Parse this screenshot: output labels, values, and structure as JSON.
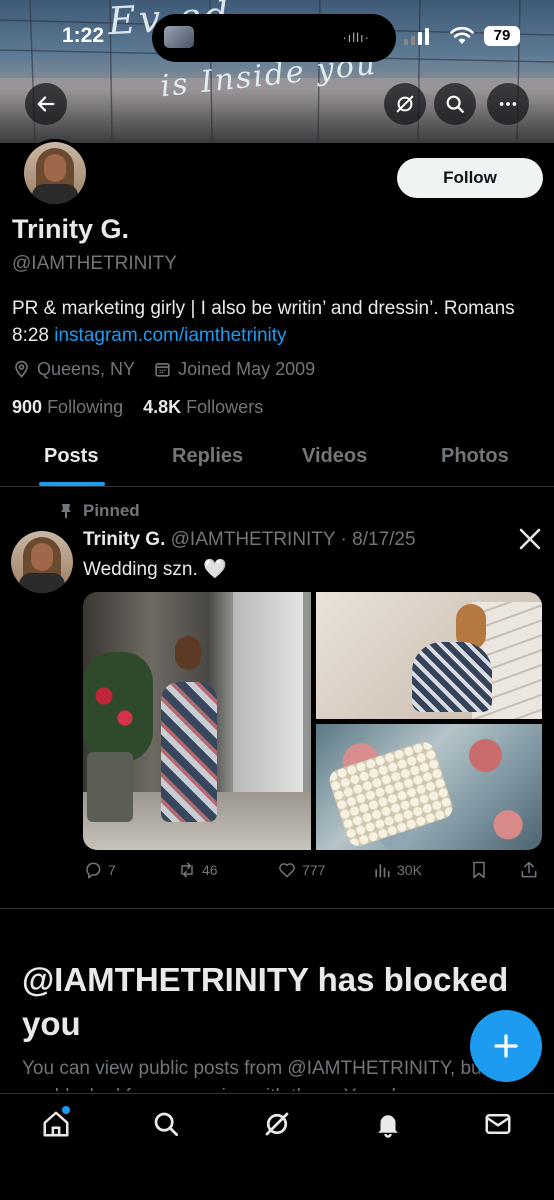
{
  "status_bar": {
    "time": "1:22",
    "battery": "79"
  },
  "banner": {
    "line1": "Ev        ed",
    "line2": "is Inside you"
  },
  "profile": {
    "follow_label": "Follow",
    "name": "Trinity G.",
    "handle": "@IAMTHETRINITY",
    "bio_text": "PR & marketing girly | I also be writin’ and dressin’. Romans 8:28 ",
    "bio_link": "instagram.com/iamthetrinity",
    "location": "Queens, NY",
    "joined": "Joined May 2009",
    "following_count": "900",
    "following_label": "Following",
    "followers_count": "4.8K",
    "followers_label": "Followers"
  },
  "tabs": [
    "Posts",
    "Replies",
    "Videos",
    "Photos"
  ],
  "post": {
    "pinned_label": "Pinned",
    "author": "Trinity G.",
    "meta": "@IAMTHETRINITY · 8/17/25",
    "text": "Wedding szn. 🤍",
    "replies": "7",
    "reposts": "46",
    "likes": "777",
    "views": "30K"
  },
  "blocked": {
    "title": "@IAMTHETRINITY has blocked you",
    "text": "You can view public posts from @IAMTHETRINITY, but you are blocked from engaging with them. You also"
  },
  "icons": {
    "back": "back-arrow-icon",
    "grok": "grok-icon",
    "search": "search-icon",
    "more": "more-icon",
    "location": "location-icon",
    "calendar": "calendar-icon",
    "pin": "pin-icon",
    "x_logo": "x-logo-icon",
    "fab": "plus-icon"
  },
  "colors": {
    "accent": "#1d9bf0",
    "muted": "#71767b",
    "text": "#e7e9ea",
    "background": "#000000"
  }
}
